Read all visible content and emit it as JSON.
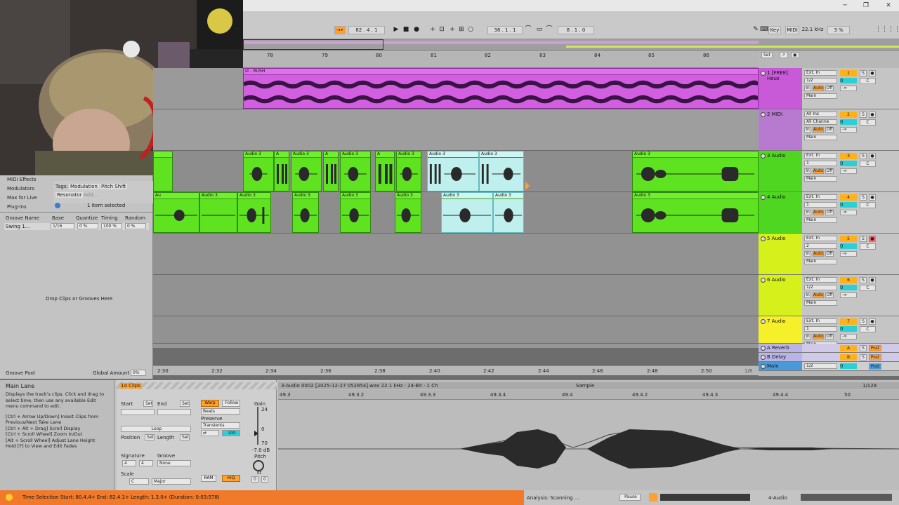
{
  "titlebar": {
    "minimize": "─",
    "restore": "❐",
    "close": "✕"
  },
  "transport": {
    "tempo_follow": "→•",
    "position": "82 . 4 . 1",
    "loop_start": "38 . 1 . 1",
    "loop_length": "8 . 1 . 0",
    "key_label": "Key",
    "midi_label": "MIDI",
    "sample_rate": "22.1 kHz",
    "cpu": "3 %"
  },
  "ruler": {
    "bars": [
      "78",
      "79",
      "80",
      "81",
      "82",
      "83",
      "84",
      "85",
      "86"
    ]
  },
  "arrangement": {
    "top_clip_title": "st - RUSH",
    "clip_label": "Audio 3",
    "clip_label_short": "A",
    "clip_label_au": "Au",
    "clip_label_4": "Audio 3"
  },
  "time_ruler": {
    "labels": [
      "2:30",
      "2:32",
      "2:34",
      "2:36",
      "2:38",
      "2:40",
      "2:42",
      "2:44",
      "2:46",
      "2:48",
      "2:50"
    ]
  },
  "header_controls": {
    "set_label": "Set",
    "zoom_label": "1/8"
  },
  "tracks": [
    {
      "name": "1 [FREE] Hous",
      "input": "Ext. In",
      "channel": "1/2",
      "output": "Main",
      "num": "1",
      "color": "#c85ad8"
    },
    {
      "name": "2 MIDI",
      "input": "All Ins",
      "channel": "All Channe",
      "output": "Main",
      "num": "2",
      "color": "#b77ad0"
    },
    {
      "name": "3 Audio",
      "input": "Ext. In",
      "channel": "1",
      "output": "Main",
      "num": "3",
      "color": "#4fd620"
    },
    {
      "name": "4 Audio",
      "input": "Ext. In",
      "channel": "1",
      "output": "Main",
      "num": "4",
      "color": "#4fd620"
    },
    {
      "name": "5 Audio",
      "input": "Ext. In",
      "channel": "2",
      "output": "Main",
      "num": "5",
      "color": "#d6f01c"
    },
    {
      "name": "6 Audio",
      "input": "Ext. In",
      "channel": "1/2",
      "output": "Main",
      "num": "6",
      "color": "#d6f01c"
    },
    {
      "name": "7 Audio",
      "input": "Ext. In",
      "channel": "1",
      "output": "Main",
      "num": "7",
      "color": "#f5f02a"
    }
  ],
  "returns": [
    {
      "name": "A Reverb",
      "letter": "A"
    },
    {
      "name": "B Delay",
      "letter": "B"
    }
  ],
  "main_track": {
    "name": "Main",
    "output": "1/2",
    "zero": "0"
  },
  "monitor": {
    "in": "In",
    "auto": "Auto",
    "off": "Off",
    "s": "S",
    "c": "C",
    "inf": "-∞",
    "zero": "0",
    "post": "Post"
  },
  "browser": {
    "items": [
      "MIDI Effects",
      "Modulators",
      "Max for Live",
      "Plug-ins"
    ],
    "tags_label": "Tags:",
    "tags": [
      "Modulation",
      "Pitch Shift",
      "Resonator",
      "Add..."
    ],
    "selected_text": "1 item selected",
    "groove_headers": [
      "Groove Name",
      "Base",
      "Quantize",
      "Timing",
      "Random"
    ],
    "groove_row": {
      "name": "Swing 1...",
      "base": "1/16",
      "quantize": "0 %",
      "timing": "100 %",
      "random": "0 %"
    },
    "drop_text": "Drop Clips or Grooves Here",
    "groove_pool": "Groove Pool",
    "global_amount_label": "Global Amount",
    "global_amount_value": "0%"
  },
  "info": {
    "title": "Main Lane",
    "lines": [
      "Displays the track's clips. Click and drag to select time, then use any available Edit menu command to edit.",
      "[Ctrl + Arrow Up/Down] Insert Clips from Previous/Next Take Lane",
      "[Ctrl + Alt + Drag] Scroll Display",
      "[Ctrl + Scroll Wheel] Zoom In/Out",
      "[Alt + Scroll Wheel] Adjust Lane Height",
      "Hold [F] to View and Edit Fades"
    ]
  },
  "clip_panel": {
    "header": "14 Clips",
    "start": "Start",
    "end": "End",
    "set": "Set",
    "loop": "Loop",
    "position": "Position",
    "length": "Length",
    "signature": "Signature",
    "sig_num": "4",
    "sig_den": "4",
    "groove": "Groove",
    "groove_val": "None",
    "scale": "Scale",
    "scale_root": "C",
    "scale_mode": "Major",
    "warp": "Warp",
    "follow": "Follow",
    "beats": "Beats",
    "preserve": "Preserve",
    "transients": "Transients",
    "warp_amount": "100",
    "gain": "Gain",
    "gain_top": "24",
    "gain_mid": "0",
    "gain_bot": "70",
    "gain_val": "-7.0 dB",
    "pitch": "Pitch",
    "st": "st",
    "pitch_a": "0",
    "pitch_b": "0",
    "ram": "RAM",
    "hiq": "HiQ"
  },
  "sample": {
    "file": "3-Audio 0002 [2025-12-27 052854].wav  22.1 kHz · 24-Bit · 1 Ch",
    "tab": "Sample",
    "zoom": "1/128",
    "ruler": [
      "49.3",
      "49.3.2",
      "49.3.3",
      "49.3.4",
      "49.4",
      "49.4.2",
      "49.4.3",
      "49.4.4",
      "50"
    ]
  },
  "status": {
    "text": "Time Selection   Start: 80.4.4+   End: 82.4.1+   Length: 1.3.0+  (Duration: 0:03:578)",
    "analysis": "Analysis: Scanning ...",
    "pause": "Pause",
    "track": "4-Audio"
  }
}
